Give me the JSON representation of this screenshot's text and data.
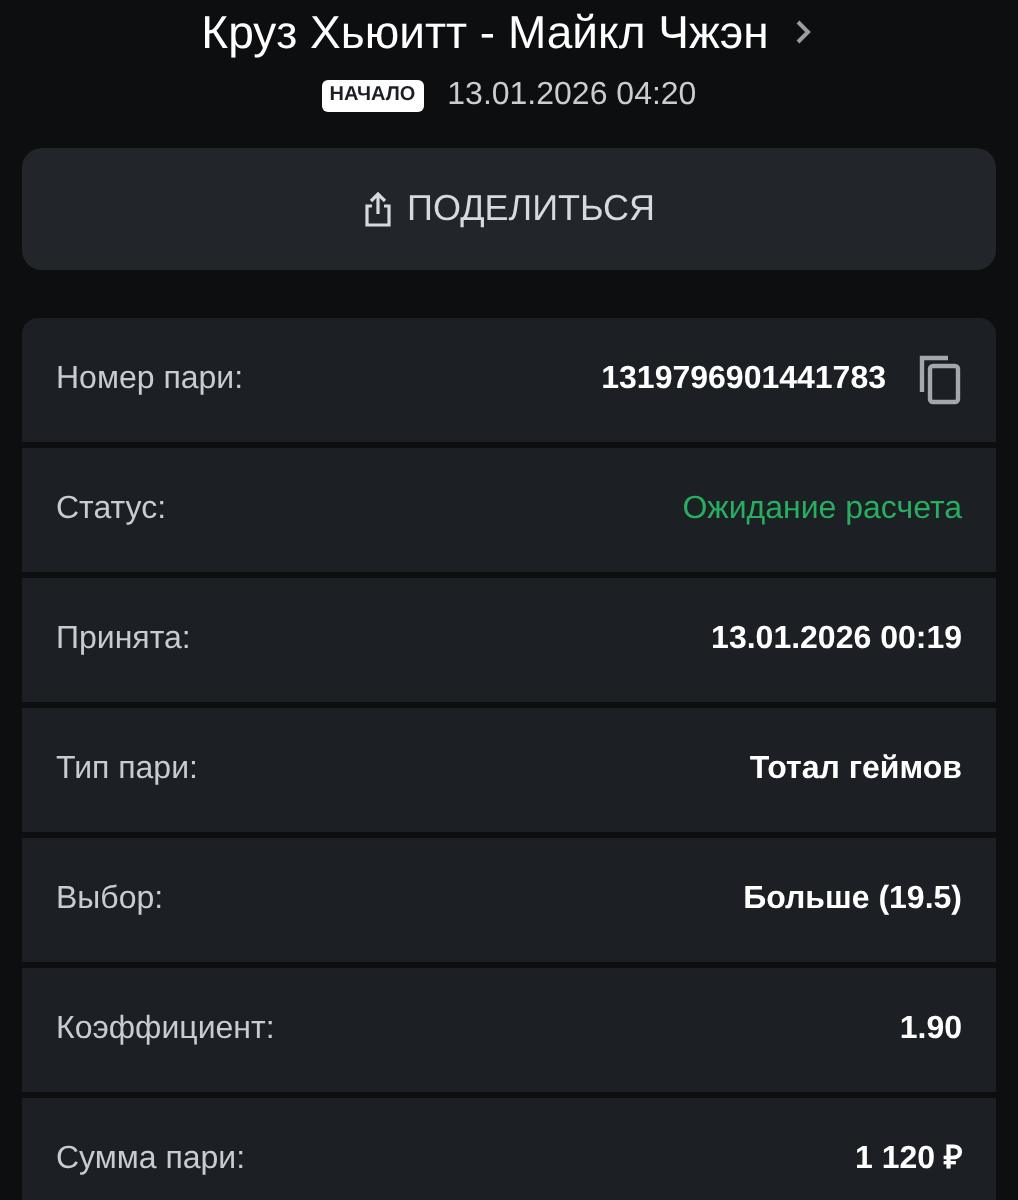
{
  "header": {
    "title": "Круз Хьюитт - Майкл Чжэн",
    "badge": "НАЧАЛО",
    "start_time": "13.01.2026 04:20"
  },
  "share_button": {
    "label": "ПОДЕЛИТЬСЯ"
  },
  "details": [
    {
      "kind": "copyable",
      "label": "Номер пари:",
      "value": "1319796901441783"
    },
    {
      "kind": "status",
      "label": "Статус:",
      "value": "Ожидание расчета"
    },
    {
      "kind": "plain",
      "label": "Принята:",
      "value": "13.01.2026 00:19"
    },
    {
      "kind": "plain",
      "label": "Тип пари:",
      "value": "Тотал геймов"
    },
    {
      "kind": "plain",
      "label": "Выбор:",
      "value": "Больше (19.5)"
    },
    {
      "kind": "plain",
      "label": "Коэффициент:",
      "value": "1.90"
    },
    {
      "kind": "plain",
      "label": "Сумма пари:",
      "value": "1 120 ₽"
    }
  ]
}
